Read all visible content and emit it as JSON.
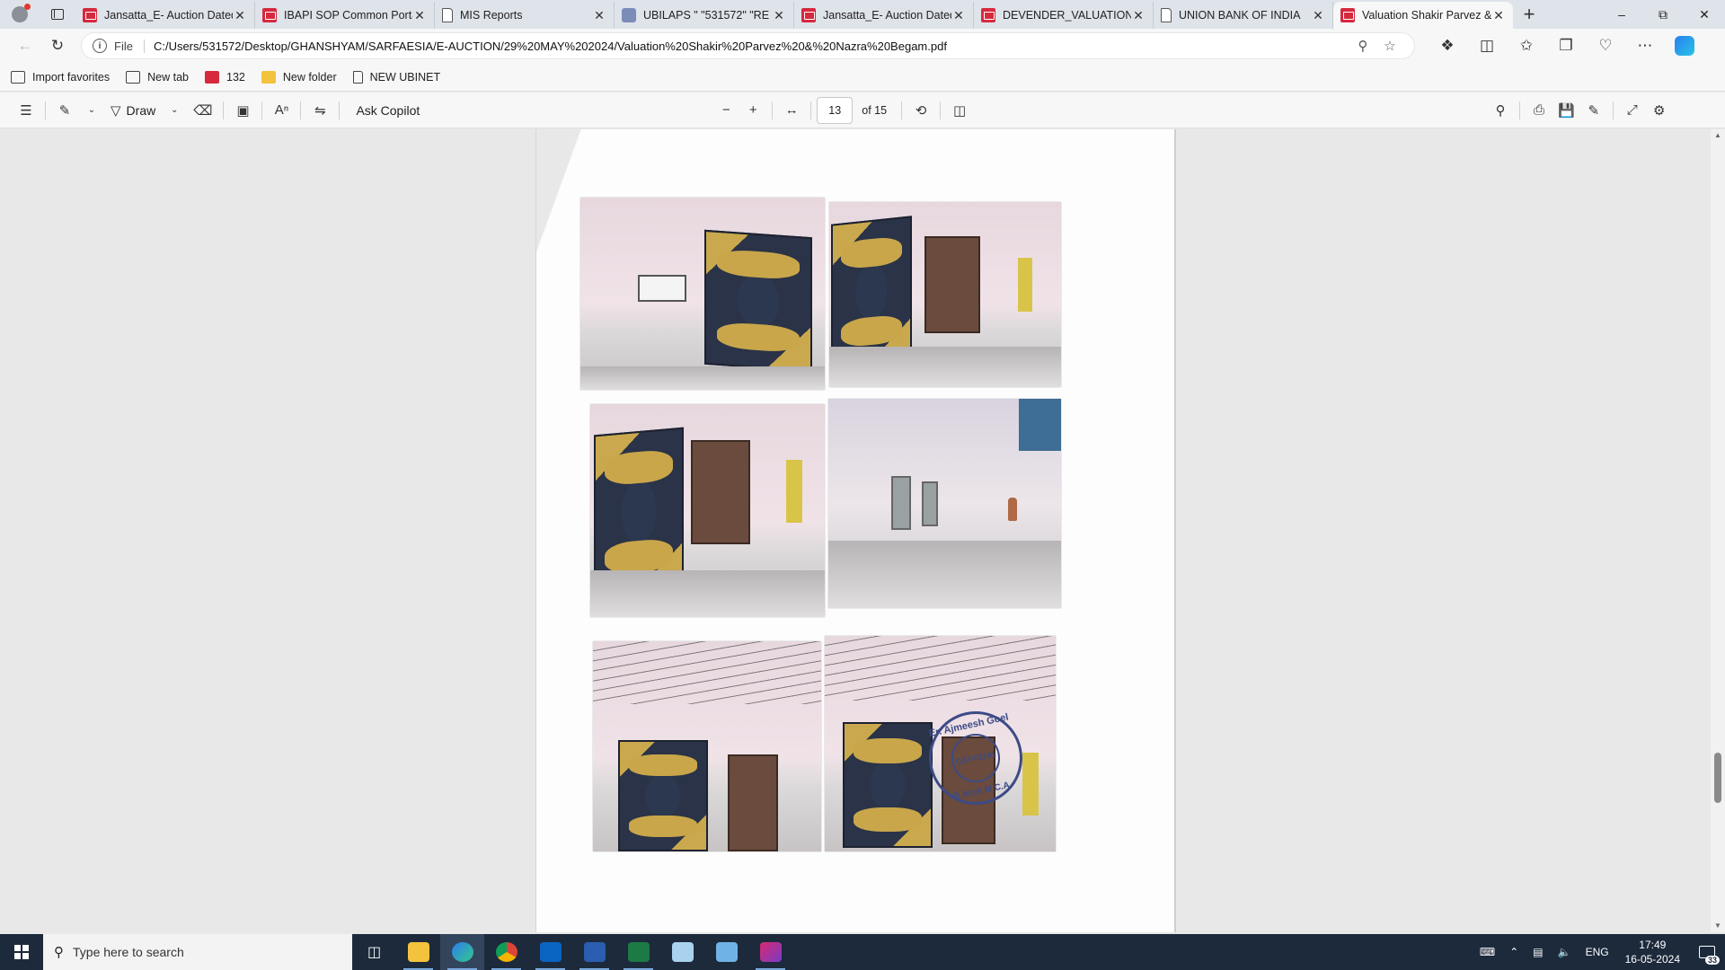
{
  "browser": {
    "tabs": [
      {
        "title": "Jansatta_E- Auction Dated",
        "icon": "pdf-icon",
        "active": false
      },
      {
        "title": "IBAPI SOP Common Portal",
        "icon": "pdf-icon",
        "active": false
      },
      {
        "title": "MIS Reports",
        "icon": "page-icon",
        "active": false
      },
      {
        "title": "UBILAPS  \" \"531572\" \"RE",
        "icon": "app-icon",
        "active": false
      },
      {
        "title": "Jansatta_E- Auction Dated",
        "icon": "pdf-icon",
        "active": false
      },
      {
        "title": "DEVENDER_VALUATION_",
        "icon": "pdf-icon",
        "active": false
      },
      {
        "title": "UNION BANK OF INDIA",
        "icon": "page-icon",
        "active": false
      },
      {
        "title": "Valuation Shakir Parvez &",
        "icon": "pdf-icon",
        "active": true
      }
    ],
    "address": {
      "scheme": "File",
      "url": "C:/Users/531572/Desktop/GHANSHYAM/SARFAESIA/E-AUCTION/29%20MAY%202024/Valuation%20Shakir%20Parvez%20&%20Nazra%20Begam.pdf"
    },
    "favorites": [
      {
        "label": "Import favorites",
        "icon": "import-icon"
      },
      {
        "label": "New tab",
        "icon": "newtab-icon"
      },
      {
        "label": "132",
        "icon": "pdf-icon"
      },
      {
        "label": "New folder",
        "icon": "folder-icon"
      },
      {
        "label": "NEW UBINET",
        "icon": "page-icon"
      }
    ]
  },
  "pdf_toolbar": {
    "draw_label": "Draw",
    "ask_copilot_label": "Ask Copilot",
    "current_page": "13",
    "page_count_label": "of 15"
  },
  "document": {
    "stamp": {
      "top_text": "Er. Ajmeesh Goel",
      "center_text": "CAT-I/2101",
      "bottom_text": "B.Arch M.C.A."
    }
  },
  "taskbar": {
    "search_placeholder": "Type here to search",
    "language": "ENG",
    "time": "17:49",
    "date": "16-05-2024",
    "notification_count": "33"
  },
  "colors": {
    "tab_strip": "#dfe3ea",
    "taskbar": "#1c2a3c",
    "pdf_accent": "#d6293e",
    "stamp_ink": "#3c4a86"
  }
}
